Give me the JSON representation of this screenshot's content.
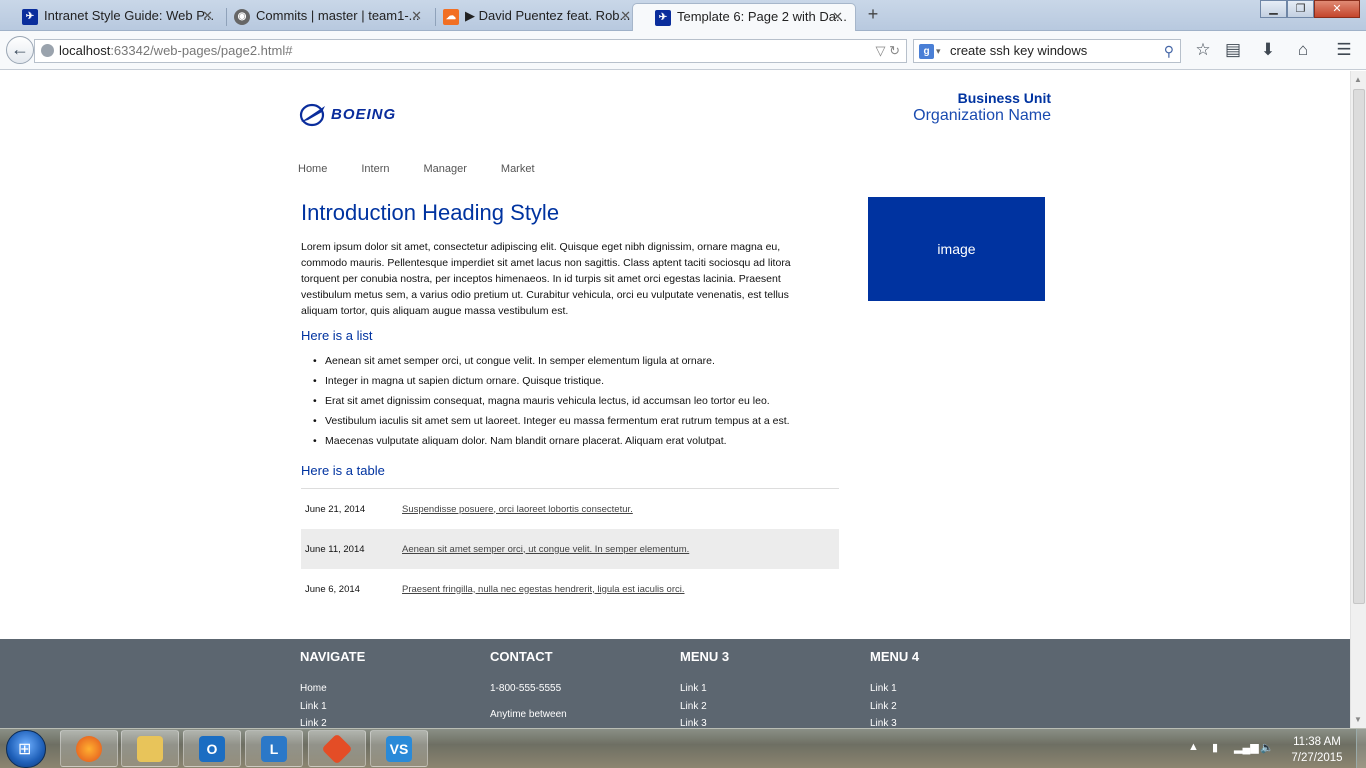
{
  "browser": {
    "tabs": [
      {
        "title": "Intranet Style Guide: Web P...",
        "favicon": "boeing-icon",
        "active": false
      },
      {
        "title": "Commits | master | team1-...",
        "favicon": "github-icon",
        "active": false
      },
      {
        "title": "▶ David Puentez feat. Rob...",
        "favicon": "soundcloud-icon",
        "active": false
      },
      {
        "title": "Template 6: Page 2 with Da...",
        "favicon": "boeing-icon",
        "active": true
      }
    ],
    "new_tab_label": "+",
    "url_host": "localhost",
    "url_rest": ":63342/web-pages/page2.html#",
    "search_value": "create ssh key windows",
    "search_engine_glyph": "g"
  },
  "page": {
    "logo_text": "BOEING",
    "business_unit": "Business Unit",
    "organization": "Organization Name",
    "nav": [
      "Home",
      "Intern",
      "Manager",
      "Market"
    ],
    "intro_heading": "Introduction Heading Style",
    "intro_text": "Lorem ipsum dolor sit amet, consectetur adipiscing elit. Quisque eget nibh dignissim, ornare magna eu, commodo mauris. Pellentesque imperdiet sit amet lacus non sagittis. Class aptent taciti sociosqu ad litora torquent per conubia nostra, per inceptos himenaeos. In id turpis sit amet orci egestas lacinia. Praesent vestibulum metus sem, a varius odio pretium ut. Curabitur vehicula, orci eu vulputate venenatis, est tellus aliquam tortor, quis aliquam augue massa vestibulum est.",
    "list_heading": "Here is a list",
    "list_items": [
      "Aenean sit amet semper orci, ut congue velit. In semper elementum ligula at ornare.",
      "Integer in magna ut sapien dictum ornare. Quisque tristique.",
      "Erat sit amet dignissim consequat, magna mauris vehicula lectus, id accumsan leo tortor eu leo.",
      "Vestibulum iaculis sit amet sem ut laoreet. Integer eu massa fermentum erat rutrum tempus at a est.",
      "Maecenas vulputate aliquam dolor. Nam blandit ornare placerat. Aliquam erat volutpat."
    ],
    "table_heading": "Here is a table",
    "table_rows": [
      {
        "date": "June 21, 2014",
        "text": "Suspendisse posuere, orci laoreet lobortis consectetur."
      },
      {
        "date": "June 11, 2014",
        "text": "Aenean sit amet semper orci, ut congue velit. In semper elementum."
      },
      {
        "date": "June 6, 2014",
        "text": "Praesent fringilla, nulla nec egestas hendrerit, ligula est iaculis orci."
      }
    ],
    "image_label": "image"
  },
  "footer": {
    "columns": [
      {
        "heading": "NAVIGATE",
        "items": [
          "Home",
          "Link 1",
          "Link 2"
        ]
      },
      {
        "heading": "CONTACT",
        "items": [
          "1-800-555-5555",
          "Anytime between"
        ]
      },
      {
        "heading": "MENU 3",
        "items": [
          "Link 1",
          "Link 2",
          "Link 3"
        ]
      },
      {
        "heading": "MENU 4",
        "items": [
          "Link 1",
          "Link 2",
          "Link 3"
        ]
      }
    ]
  },
  "taskbar": {
    "apps": [
      "firefox-icon",
      "explorer-icon",
      "outlook-icon",
      "lync-icon",
      "git-icon",
      "visual-studio-icon"
    ],
    "time": "11:38 AM",
    "date": "7/27/2015"
  },
  "colors": {
    "brand_blue": "#0033a0",
    "footer_gray": "#5c6670"
  }
}
